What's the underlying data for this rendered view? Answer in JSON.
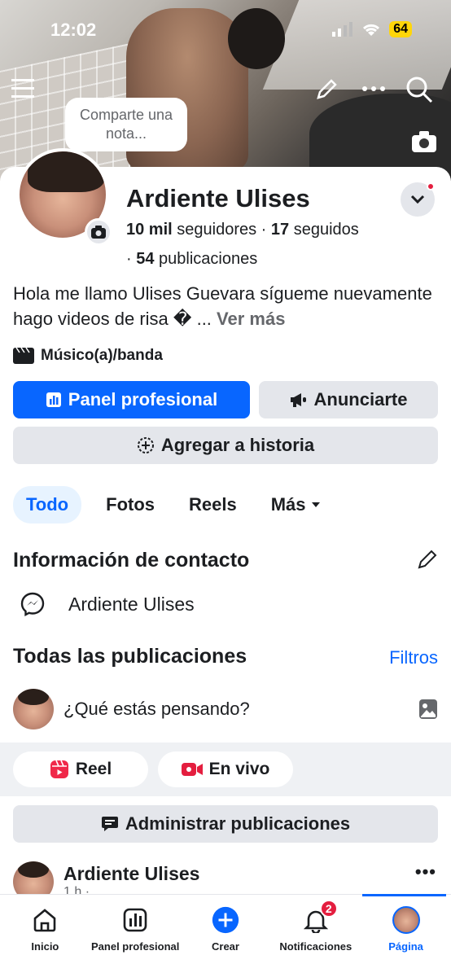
{
  "status_bar": {
    "time": "12:02",
    "battery": "64"
  },
  "cover": {
    "note_text": "Comparte una nota..."
  },
  "profile": {
    "name": "Ardiente Ulises",
    "followers_count": "10 mil",
    "followers_label": "seguidores",
    "following_count": "17",
    "following_label": "seguidos",
    "posts_count": "54",
    "posts_label": "publicaciones",
    "bio": "Hola me llamo Ulises Guevara sígueme nuevamente hago videos de risa � ...",
    "bio_more": "Ver más",
    "category": "Músico(a)/banda"
  },
  "actions": {
    "panel": "Panel profesional",
    "advertise": "Anunciarte",
    "add_story": "Agregar a historia"
  },
  "tabs": [
    "Todo",
    "Fotos",
    "Reels",
    "Más"
  ],
  "contact": {
    "title": "Información de contacto",
    "messenger": "Ardiente Ulises"
  },
  "posts": {
    "title": "Todas las publicaciones",
    "filters": "Filtros",
    "composer_placeholder": "¿Qué estás pensando?",
    "reel": "Reel",
    "live": "En vivo",
    "manage": "Administrar publicaciones",
    "first_post_author": "Ardiente Ulises",
    "first_post_time": "1 h ·"
  },
  "bottom_nav": [
    {
      "label": "Inicio",
      "icon": "home-icon"
    },
    {
      "label": "Panel profesional",
      "icon": "dashboard-icon"
    },
    {
      "label": "Crear",
      "icon": "plus-icon"
    },
    {
      "label": "Notificaciones",
      "icon": "bell-icon",
      "badge": "2"
    },
    {
      "label": "Página",
      "icon": "avatar"
    }
  ],
  "colors": {
    "accent": "#0866ff",
    "badge": "#e41e3f",
    "gray_button": "#e4e6eb"
  }
}
